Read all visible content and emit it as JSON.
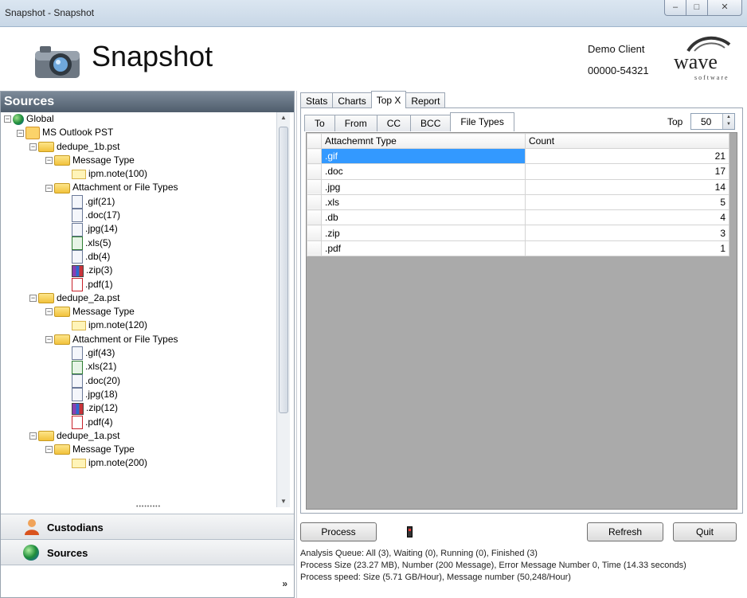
{
  "window": {
    "title": "Snapshot - Snapshot",
    "min": "–",
    "max": "□",
    "close": "✕"
  },
  "header": {
    "app_title": "Snapshot",
    "client_name": "Demo Client",
    "client_id": "00000-54321",
    "logo_word": "wave",
    "logo_sub": "software"
  },
  "sidebar": {
    "title": "Sources",
    "tree": [
      {
        "label": "Global",
        "level": 0,
        "icon": "globe-icon",
        "expand": "−"
      },
      {
        "label": "MS Outlook PST",
        "level": 1,
        "icon": "pst-icon",
        "expand": "−"
      },
      {
        "label": "dedupe_1b.pst",
        "level": 2,
        "icon": "folder-icon",
        "expand": "−"
      },
      {
        "label": "Message Type",
        "level": 3,
        "icon": "folder-icon",
        "expand": "−"
      },
      {
        "label": "ipm.note(100)",
        "level": 4,
        "icon": "mail-icon"
      },
      {
        "label": "Attachment or File Types",
        "level": 3,
        "icon": "folder-icon",
        "expand": "−"
      },
      {
        "label": ".gif(21)",
        "level": 4,
        "icon": "file-icon"
      },
      {
        "label": ".doc(17)",
        "level": 4,
        "icon": "file-icon"
      },
      {
        "label": ".jpg(14)",
        "level": 4,
        "icon": "file-icon"
      },
      {
        "label": ".xls(5)",
        "level": 4,
        "icon": "xls-icon"
      },
      {
        "label": ".db(4)",
        "level": 4,
        "icon": "file-icon"
      },
      {
        "label": ".zip(3)",
        "level": 4,
        "icon": "zip-icon"
      },
      {
        "label": ".pdf(1)",
        "level": 4,
        "icon": "pdf-icon"
      },
      {
        "label": "dedupe_2a.pst",
        "level": 2,
        "icon": "folder-icon",
        "expand": "−"
      },
      {
        "label": "Message Type",
        "level": 3,
        "icon": "folder-icon",
        "expand": "−"
      },
      {
        "label": "ipm.note(120)",
        "level": 4,
        "icon": "mail-icon"
      },
      {
        "label": "Attachment or File Types",
        "level": 3,
        "icon": "folder-icon",
        "expand": "−"
      },
      {
        "label": ".gif(43)",
        "level": 4,
        "icon": "file-icon"
      },
      {
        "label": ".xls(21)",
        "level": 4,
        "icon": "xls-icon"
      },
      {
        "label": ".doc(20)",
        "level": 4,
        "icon": "file-icon"
      },
      {
        "label": ".jpg(18)",
        "level": 4,
        "icon": "file-icon"
      },
      {
        "label": ".zip(12)",
        "level": 4,
        "icon": "zip-icon"
      },
      {
        "label": ".pdf(4)",
        "level": 4,
        "icon": "pdf-icon"
      },
      {
        "label": "dedupe_1a.pst",
        "level": 2,
        "icon": "folder-icon",
        "expand": "−"
      },
      {
        "label": "Message Type",
        "level": 3,
        "icon": "folder-icon",
        "expand": "−"
      },
      {
        "label": "ipm.note(200)",
        "level": 4,
        "icon": "mail-icon"
      }
    ],
    "nav": {
      "custodians": "Custodians",
      "sources": "Sources",
      "chevron": "»"
    }
  },
  "main": {
    "tabs": [
      "Stats",
      "Charts",
      "Top X",
      "Report"
    ],
    "active_tab": "Top X",
    "subtabs": [
      "To",
      "From",
      "CC",
      "BCC",
      "File Types"
    ],
    "active_subtab": "File Types",
    "top_label": "Top",
    "top_value": "50",
    "table": {
      "columns": [
        "Attachemnt Type",
        "Count"
      ],
      "rows": [
        {
          "type": ".gif",
          "count": "21"
        },
        {
          "type": ".doc",
          "count": "17"
        },
        {
          "type": ".jpg",
          "count": "14"
        },
        {
          "type": ".xls",
          "count": "5"
        },
        {
          "type": ".db",
          "count": "4"
        },
        {
          "type": ".zip",
          "count": "3"
        },
        {
          "type": ".pdf",
          "count": "1"
        }
      ],
      "selected_row": 0
    },
    "buttons": {
      "process": "Process",
      "refresh": "Refresh",
      "quit": "Quit"
    },
    "status": [
      "Analysis Queue: All (3), Waiting (0), Running (0), Finished (3)",
      "Process Size (23.27 MB), Number (200 Message), Error Message Number 0, Time (14.33 seconds)",
      "Process speed: Size (5.71 GB/Hour), Message number (50,248/Hour)"
    ]
  }
}
